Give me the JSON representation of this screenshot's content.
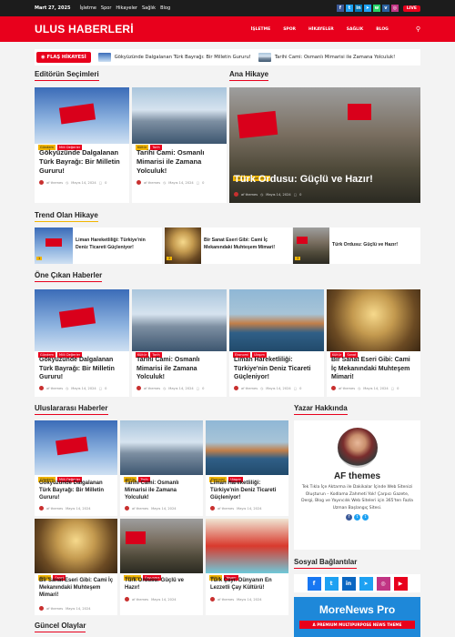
{
  "topbar": {
    "date": "Mart 27, 2025",
    "links": [
      "İşletme",
      "Spor",
      "Hikayeler",
      "Sağlık",
      "Blog"
    ],
    "live": "LIVE"
  },
  "header": {
    "logo": "ULUS HABERLERİ",
    "nav": [
      "İŞLETME",
      "SPOR",
      "HİKAYELER",
      "SAĞLIK",
      "BLOG"
    ]
  },
  "ticker": {
    "badge": "FLAŞ HİKAYESİ",
    "items": [
      "Gökyüzünde Dalgalanan Türk Bayrağı: Bir Milletin Gururu!",
      "Tarihi Cami: Osmanlı Mimarisi ile Zamana Yolculuk!"
    ]
  },
  "editor": {
    "title": "Editörün Seçimleri",
    "cards": [
      {
        "cats": [
          "Gündem",
          "Milli Değerler"
        ],
        "title": "Gökyüzünde Dalgalanan Türk Bayrağı: Bir Milletin Gururu!",
        "author": "af themes",
        "date": "Mayıs 14, 2024",
        "comments": "0"
      },
      {
        "cats": [
          "Kültür",
          "Tarih"
        ],
        "title": "Tarihi Cami: Osmanlı Mimarisi ile Zamana Yolculuk!",
        "author": "af themes",
        "date": "Mayıs 14, 2024",
        "comments": "0"
      }
    ]
  },
  "main_story": {
    "title": "Ana Hikaye",
    "cats": [
      "Gündem",
      "Savunma"
    ],
    "headline": "Türk Ordusu: Güçlü ve Hazır!",
    "author": "af themes",
    "date": "Mayıs 14, 2024",
    "comments": "0"
  },
  "trend": {
    "title": "Trend Olan Hikaye",
    "items": [
      {
        "n": "1",
        "text": "Liman Hareketliliği: Türkiye'nin Deniz Ticareti Güçleniyor!"
      },
      {
        "n": "2",
        "text": "Bir Sanat Eseri Gibi: Cami İç Mekanındaki Muhteşem Mimari!"
      },
      {
        "n": "3",
        "text": "Türk Ordusu: Güçlü ve Hazır!"
      }
    ]
  },
  "featured": {
    "title": "Öne Çıkan Haberler",
    "cards": [
      {
        "cats": [
          "Gündem",
          "Milli Değerler"
        ],
        "title": "Gökyüzünde Dalgalanan Türk Bayrağı: Bir Milletin Gururu!",
        "author": "af themes",
        "date": "Mayıs 14, 2024",
        "comments": "0"
      },
      {
        "cats": [
          "Kültür",
          "Tarih"
        ],
        "title": "Tarihi Cami: Osmanlı Mimarisi ile Zamana Yolculuk!",
        "author": "af themes",
        "date": "Mayıs 14, 2024",
        "comments": "0"
      },
      {
        "cats": [
          "Ekonomi",
          "Ulaşım"
        ],
        "title": "Liman Hareketliliği: Türkiye'nin Deniz Ticareti Güçleniyor!",
        "author": "af themes",
        "date": "Mayıs 14, 2024",
        "comments": "0"
      },
      {
        "cats": [
          "Kültür",
          "Sanat"
        ],
        "title": "Bir Sanat Eseri Gibi: Cami İç Mekanındaki Muhteşem Mimari!",
        "author": "af themes",
        "date": "Mayıs 14, 2024",
        "comments": "0"
      }
    ]
  },
  "intl": {
    "title": "Uluslararası Haberler",
    "cards": [
      {
        "cats": [
          "Gündem",
          "Milli Değerler"
        ],
        "title": "Gökyüzünde Dalgalanan Türk Bayrağı: Bir Milletin Gururu!",
        "author": "af themes",
        "date": "Mayıs 14, 2024"
      },
      {
        "cats": [
          "Kültür",
          "Tarih"
        ],
        "title": "Tarihi Cami: Osmanlı Mimarisi ile Zamana Yolculuk!",
        "author": "af themes",
        "date": "Mayıs 14, 2024"
      },
      {
        "cats": [
          "Ekonomi",
          "Ulaşım"
        ],
        "title": "Liman Hareketliliği: Türkiye'nin Deniz Ticareti Güçleniyor!",
        "author": "af themes",
        "date": "Mayıs 14, 2024"
      },
      {
        "cats": [
          "Kültür",
          "Sanat"
        ],
        "title": "Bir Sanat Eseri Gibi: Cami İç Mekanındaki Muhteşem Mimari!",
        "author": "af themes",
        "date": "Mayıs 14, 2024"
      },
      {
        "cats": [
          "Gündem",
          "Savunma"
        ],
        "title": "Türk Ordusu: Güçlü ve Hazır!",
        "author": "af themes",
        "date": "Mayıs 14, 2024"
      },
      {
        "cats": [
          "Kültür",
          "Yaşam"
        ],
        "title": "Türk Çayı: Dünyanın En Lezzetli Çay Kültürü!",
        "author": "af themes",
        "date": "Mayıs 14, 2024"
      }
    ]
  },
  "about": {
    "title": "Yazar Hakkında",
    "name": "AF themes",
    "bio": "Tek Tıkla İçe Aktarma ile Dakikalar İçinde Web Sitenizi Oluşturun – Kodlama Zahmeti Yok! Çarpıcı Gazete, Dergi, Blog ve Yayıncılık Web Siteleri için 365'ten Fazla Uzman Başlangıç Sitesi."
  },
  "social": {
    "title": "Sosyal Bağlantılar"
  },
  "promo": {
    "title": "MoreNews Pro",
    "subtitle": "A PREMIUM MULTIPURPOSE NEWS THEME"
  },
  "current": {
    "title": "Güncel Olaylar"
  },
  "colors": {
    "brand": "#e8001c",
    "accent": "#f1b500"
  }
}
